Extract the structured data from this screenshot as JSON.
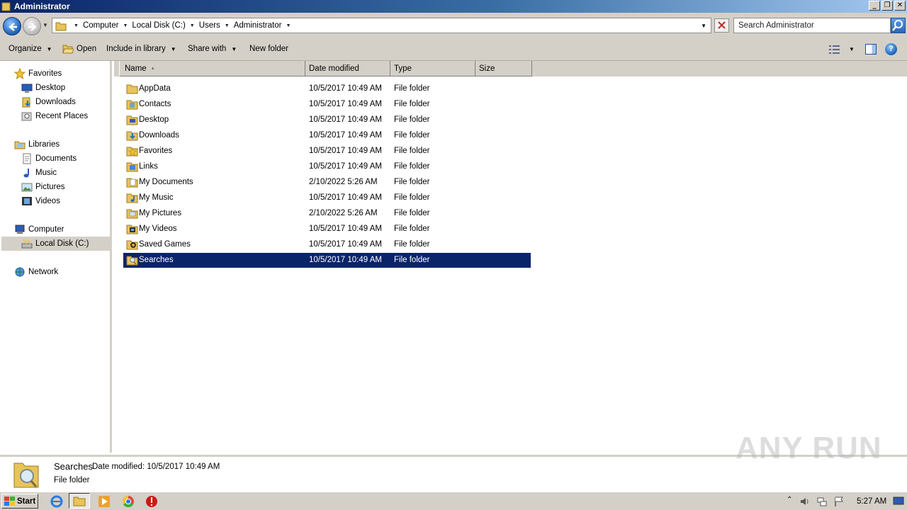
{
  "window": {
    "title": "Administrator",
    "buttons": [
      "_",
      "❐",
      "✕"
    ]
  },
  "address": {
    "crumbs": [
      "Computer",
      "Local Disk (C:)",
      "Users",
      "Administrator"
    ],
    "search_placeholder": "Search Administrator"
  },
  "toolbar": {
    "organize": "Organize",
    "open": "Open",
    "include_in_library": "Include in library",
    "share_with": "Share with",
    "new_folder": "New folder"
  },
  "nav": {
    "favorites": "Favorites",
    "desktop": "Desktop",
    "downloads": "Downloads",
    "recent_places": "Recent Places",
    "libraries": "Libraries",
    "documents": "Documents",
    "music": "Music",
    "pictures": "Pictures",
    "videos": "Videos",
    "computer": "Computer",
    "local_disk": "Local Disk (C:)",
    "network": "Network"
  },
  "columns": {
    "name": "Name",
    "date_modified": "Date modified",
    "type": "Type",
    "size": "Size"
  },
  "files": [
    {
      "name": "AppData",
      "date": "10/5/2017 10:49 AM",
      "type": "File folder",
      "icon": "folder-icon"
    },
    {
      "name": "Contacts",
      "date": "10/5/2017 10:49 AM",
      "type": "File folder",
      "icon": "contacts-folder-icon"
    },
    {
      "name": "Desktop",
      "date": "10/5/2017 10:49 AM",
      "type": "File folder",
      "icon": "desktop-folder-icon"
    },
    {
      "name": "Downloads",
      "date": "10/5/2017 10:49 AM",
      "type": "File folder",
      "icon": "downloads-folder-icon"
    },
    {
      "name": "Favorites",
      "date": "10/5/2017 10:49 AM",
      "type": "File folder",
      "icon": "favorites-folder-icon"
    },
    {
      "name": "Links",
      "date": "10/5/2017 10:49 AM",
      "type": "File folder",
      "icon": "links-folder-icon"
    },
    {
      "name": "My Documents",
      "date": "2/10/2022 5:26 AM",
      "type": "File folder",
      "icon": "documents-folder-icon"
    },
    {
      "name": "My Music",
      "date": "10/5/2017 10:49 AM",
      "type": "File folder",
      "icon": "music-folder-icon"
    },
    {
      "name": "My Pictures",
      "date": "2/10/2022 5:26 AM",
      "type": "File folder",
      "icon": "pictures-folder-icon"
    },
    {
      "name": "My Videos",
      "date": "10/5/2017 10:49 AM",
      "type": "File folder",
      "icon": "videos-folder-icon"
    },
    {
      "name": "Saved Games",
      "date": "10/5/2017 10:49 AM",
      "type": "File folder",
      "icon": "saved-games-folder-icon"
    },
    {
      "name": "Searches",
      "date": "10/5/2017 10:49 AM",
      "type": "File folder",
      "icon": "searches-folder-icon",
      "selected": true
    }
  ],
  "details": {
    "name": "Searches",
    "modified_label": "Date modified:",
    "modified_value": "10/5/2017 10:49 AM",
    "type": "File folder"
  },
  "watermark": "ANY RUN",
  "taskbar": {
    "start": "Start",
    "time": "5:27 AM"
  },
  "colors": {
    "selection": "#0a246a",
    "chrome": "#d4d0c8",
    "folder": "#e8c45a"
  }
}
